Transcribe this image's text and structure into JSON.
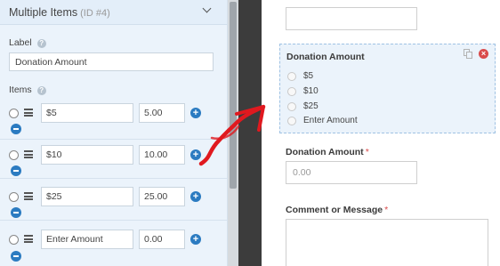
{
  "left_panel": {
    "title": "Multiple Items",
    "field_id": "(ID #4)",
    "label_heading": "Label",
    "label_value": "Donation Amount",
    "items_heading": "Items",
    "help_glyph": "?",
    "items": [
      {
        "label": "$5",
        "value": "5.00"
      },
      {
        "label": "$10",
        "value": "10.00"
      },
      {
        "label": "$25",
        "value": "25.00"
      },
      {
        "label": "Enter Amount",
        "value": "0.00"
      }
    ],
    "add_glyph": "+"
  },
  "preview": {
    "selected_field": {
      "title": "Donation Amount",
      "choices": [
        "$5",
        "$10",
        "$25",
        "Enter Amount"
      ],
      "delete_glyph": "×"
    },
    "amount_field": {
      "label": "Donation Amount",
      "required_mark": "*",
      "placeholder": "0.00"
    },
    "message_field": {
      "label": "Comment or Message",
      "required_mark": "*"
    }
  },
  "colors": {
    "panel_bg": "#ebf3fb",
    "accent_blue": "#2b7bc1",
    "arrow_red": "#e0191f",
    "delete_red": "#d94b4b"
  }
}
